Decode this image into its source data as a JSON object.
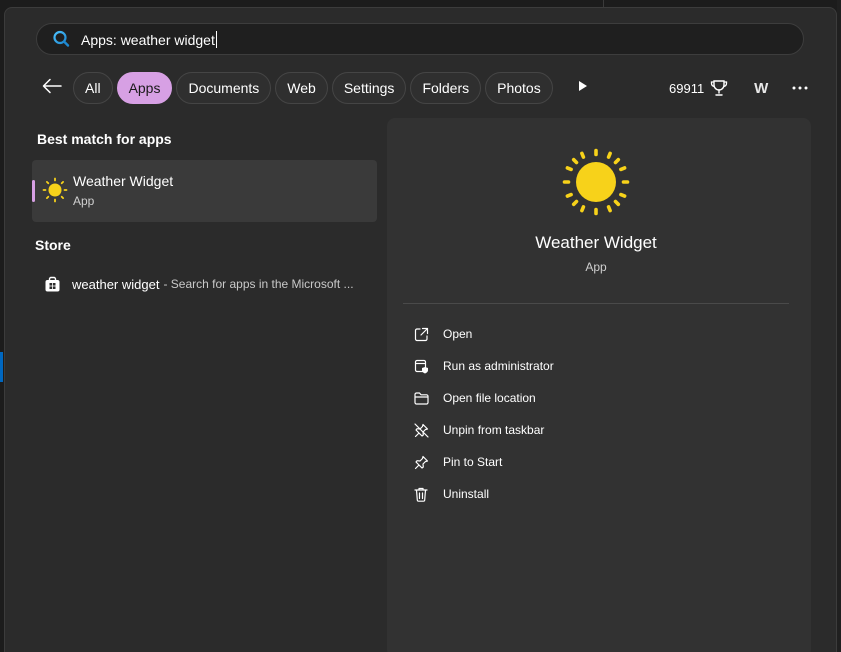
{
  "search": {
    "query": "Apps: weather widget"
  },
  "filters": {
    "back_icon": "back-arrow-icon",
    "chips": [
      {
        "label": "All",
        "active": false
      },
      {
        "label": "Apps",
        "active": true
      },
      {
        "label": "Documents",
        "active": false
      },
      {
        "label": "Web",
        "active": false
      },
      {
        "label": "Settings",
        "active": false
      },
      {
        "label": "Folders",
        "active": false
      },
      {
        "label": "Photos",
        "active": false
      }
    ],
    "play_icon": "play-icon"
  },
  "toolbar": {
    "points": "69911",
    "avatar_letter": "W"
  },
  "best_match": {
    "section_title": "Best match for apps",
    "name": "Weather Widget",
    "type": "App",
    "icon": "sun-icon"
  },
  "store": {
    "section_title": "Store",
    "name": "weather widget",
    "description": "- Search for apps in the Microsoft ...",
    "icon": "store-icon"
  },
  "details": {
    "title": "Weather Widget",
    "subtitle": "App",
    "actions": [
      {
        "label": "Open",
        "icon": "open-external-icon"
      },
      {
        "label": "Run as administrator",
        "icon": "shield-window-icon"
      },
      {
        "label": "Open file location",
        "icon": "folder-icon"
      },
      {
        "label": "Unpin from taskbar",
        "icon": "unpin-icon"
      },
      {
        "label": "Pin to Start",
        "icon": "pin-icon"
      },
      {
        "label": "Uninstall",
        "icon": "trash-icon"
      }
    ]
  },
  "colors": {
    "accent": "#d7a0e4",
    "sun": "#f7d21a",
    "panel": "#2b2b2b",
    "details": "#323232"
  }
}
